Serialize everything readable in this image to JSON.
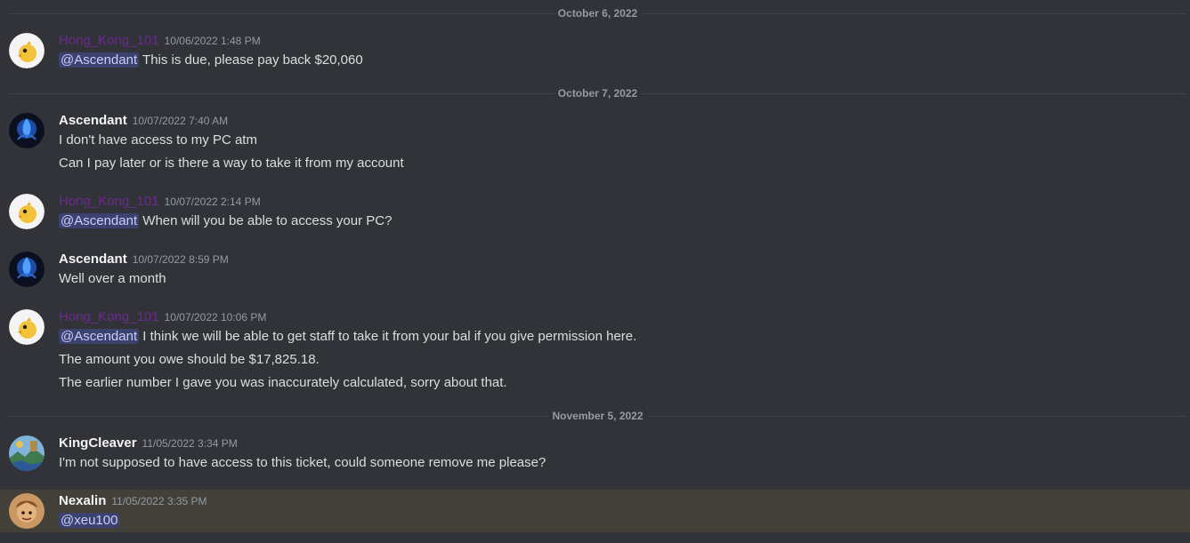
{
  "dividers": [
    {
      "label": "October 6, 2022"
    },
    {
      "label": "October 7, 2022"
    },
    {
      "label": "November 5, 2022"
    }
  ],
  "messages": [
    {
      "user": "Hong_Kong_101",
      "timestamp": "10/06/2022 1:48 PM",
      "avatar": "yellow-bird-avatar",
      "mention": "@Ascendant",
      "lines": [
        "This is due, please pay back $20,060"
      ]
    },
    {
      "user": "Ascendant",
      "timestamp": "10/07/2022 7:40 AM",
      "avatar": "blue-abstract-avatar",
      "lines": [
        "I don't have access to my PC atm",
        "Can I pay later or is there a way to take it from my account"
      ]
    },
    {
      "user": "Hong_Kong_101",
      "timestamp": "10/07/2022 2:14 PM",
      "avatar": "yellow-bird-avatar",
      "mention": "@Ascendant",
      "lines": [
        "When will you be able to access your PC?"
      ]
    },
    {
      "user": "Ascendant",
      "timestamp": "10/07/2022 8:59 PM",
      "avatar": "blue-abstract-avatar",
      "lines": [
        "Well over a month"
      ]
    },
    {
      "user": "Hong_Kong_101",
      "timestamp": "10/07/2022 10:06 PM",
      "avatar": "yellow-bird-avatar",
      "mention": "@Ascendant",
      "lines": [
        "I think we will be able to get staff to take it from your bal if you give permission here.",
        "The amount you owe should be $17,825.18.",
        "The earlier number I gave you was inaccurately calculated, sorry about that."
      ]
    },
    {
      "user": "KingCleaver",
      "timestamp": "11/05/2022 3:34 PM",
      "avatar": "landscape-avatar",
      "lines": [
        "I'm not supposed to have access to this ticket, could someone remove me please?"
      ]
    },
    {
      "user": "Nexalin",
      "timestamp": "11/05/2022 3:35 PM",
      "avatar": "character-avatar",
      "mention": "@xeu100",
      "lines": []
    }
  ],
  "colors": {
    "background": "#313338",
    "highlight": "#433f39",
    "username_role": "#6b2a91",
    "mention_bg": "#3c4270",
    "mention_text": "#c9cdfb",
    "timestamp": "#949ba4"
  }
}
